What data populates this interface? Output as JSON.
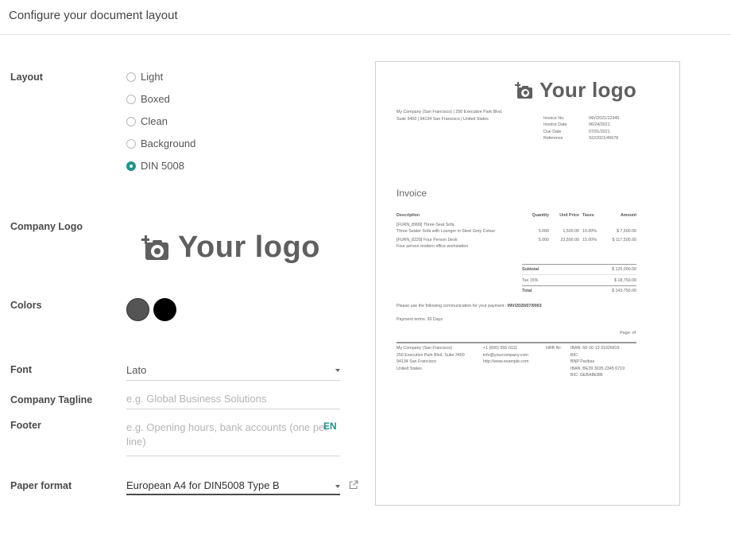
{
  "header": {
    "title": "Configure your document layout"
  },
  "layout": {
    "label": "Layout",
    "options": [
      {
        "label": "Light",
        "selected": false
      },
      {
        "label": "Boxed",
        "selected": false
      },
      {
        "label": "Clean",
        "selected": false
      },
      {
        "label": "Background",
        "selected": false
      },
      {
        "label": "DIN 5008",
        "selected": true
      }
    ]
  },
  "company_logo": {
    "label": "Company Logo",
    "text": "Your logo",
    "icon": "camera-plus-icon"
  },
  "colors": {
    "label": "Colors",
    "primary": "#555555",
    "secondary": "#000000",
    "accent": "#1c958c"
  },
  "font": {
    "label": "Font",
    "value": "Lato"
  },
  "tagline": {
    "label": "Company Tagline",
    "placeholder": "e.g. Global Business Solutions"
  },
  "footer": {
    "label": "Footer",
    "placeholder_line1": "e.g. Opening hours, bank accounts (one per",
    "placeholder_line2": "line)",
    "lang": "EN"
  },
  "paper_format": {
    "label": "Paper format",
    "value": "European A4 for DIN5008 Type B",
    "link_icon": "external-link-icon"
  },
  "preview": {
    "logo_text": "Your logo",
    "address_line1": "My Company (San Francisco) | 250 Executive Park Blvd,",
    "address_line2": "Suite 3400 | 94134 San Francisco | United States",
    "meta": [
      {
        "k": "Invoice No.",
        "v": "INV/2021/12345"
      },
      {
        "k": "Invoice Date",
        "v": "06/24/2021"
      },
      {
        "k": "Due Date",
        "v": "07/01/2021"
      },
      {
        "k": "Reference",
        "v": "SO/2021/45678"
      }
    ],
    "title": "Invoice",
    "columns": [
      "Description",
      "Quantity",
      "Unit Price",
      "Taxes",
      "Amount"
    ],
    "lines": [
      {
        "ref": "[FURN_8999] Three-Seat Sofa",
        "desc": "Three Seater Sofa with Lounger in Steel Grey Colour",
        "qty": "5.000",
        "price": "1,500.00",
        "tax": "15.00%",
        "amount": "$ 7,500.00"
      },
      {
        "ref": "[FURN_8220] Four Person Desk",
        "desc": "Four person modern office workstation",
        "qty": "5.000",
        "price": "23,500.00",
        "tax": "15.00%",
        "amount": "$ 117,500.00"
      }
    ],
    "subtotal_label": "Subtotal",
    "subtotal": "$ 125,000.00",
    "tax_label": "Tax 15%",
    "tax": "$ 18,750.00",
    "total_label": "Total",
    "total": "$ 143,750.00",
    "communication_label": "Please use the following communication for your payment :",
    "communication": "INV/2020/07/0003",
    "payment_terms": "Payment terms: 30 Days",
    "page": "Page: of",
    "footer_col1": [
      "My Company (San Francisco)",
      "250 Executive Park Blvd, Suite 3400",
      "94134 San Francisco",
      "United States"
    ],
    "footer_col2": [
      "+1 (650) 555-0111",
      "info@yourcompany.com",
      "http://www.example.com"
    ],
    "footer_col3": [
      "HRB Nr:"
    ],
    "footer_col4": [
      "IBAN: 60-16-13 31926819",
      "BIC:",
      "BNP Paribas",
      "IBAN: BE39 3035 2345 6719",
      "BIC: GEBABEBB"
    ]
  }
}
